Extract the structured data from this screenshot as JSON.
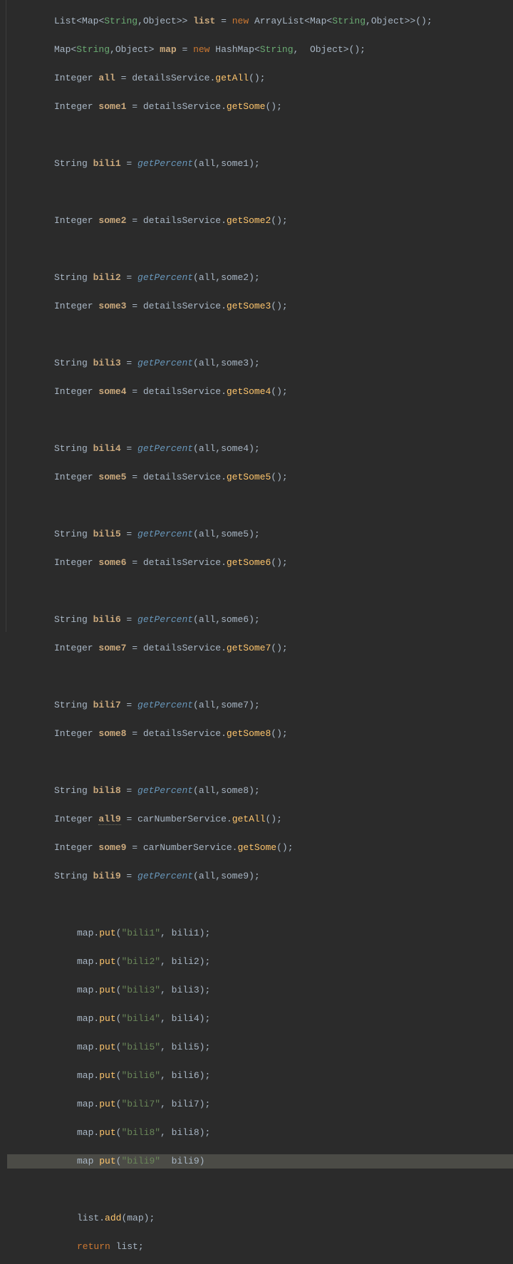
{
  "code": {
    "l1": {
      "t1": "List",
      "t2": "<",
      "t3": "Map",
      "t4": "<",
      "t5": "String",
      "t6": ",",
      "t7": "Object",
      "t8": ">> ",
      "v": "list",
      "eq": " = ",
      "new": "new",
      "sp": " ",
      "cls": "ArrayList",
      "g1": "<",
      "g2": "Map",
      "g3": "<",
      "g4": "String",
      "g5": ",",
      "g6": "Object",
      "g7": ">>",
      "end": "();"
    },
    "l2": {
      "t1": "Map",
      "t2": "<",
      "t3": "String",
      "t4": ",",
      "t5": "Object",
      "t6": "> ",
      "v": "map",
      "eq": " = ",
      "new": "new",
      "sp": " ",
      "cls": "HashMap",
      "g1": "<",
      "g2": "String",
      "g3": ",  ",
      "g4": "Object",
      "g5": ">",
      "end": "();"
    },
    "l3": {
      "t": "Integer ",
      "v": "all",
      "eq": " = ",
      "svc": "detailsService",
      "dot": ".",
      "m": "getAll",
      "end": "();"
    },
    "l4": {
      "t": "Integer ",
      "v": "some1",
      "eq": " = ",
      "svc": "detailsService",
      "dot": ".",
      "m": "getSome",
      "end": "();"
    },
    "b1": {
      "t": "String ",
      "v": "bili1",
      "eq": " = ",
      "f": "getPercent",
      "op": "(",
      "a1": "all",
      "c": ",",
      "a2": "some1",
      "cl": ");"
    },
    "s2": {
      "t": "Integer ",
      "v": "some2",
      "eq": " = ",
      "svc": "detailsService",
      "dot": ".",
      "m": "getSome2",
      "end": "();"
    },
    "b2": {
      "t": "String ",
      "v": "bili2",
      "eq": " = ",
      "f": "getPercent",
      "op": "(",
      "a1": "all",
      "c": ",",
      "a2": "some2",
      "cl": ");"
    },
    "s3": {
      "t": "Integer ",
      "v": "some3",
      "eq": " = ",
      "svc": "detailsService",
      "dot": ".",
      "m": "getSome3",
      "end": "();"
    },
    "b3": {
      "t": "String ",
      "v": "bili3",
      "eq": " = ",
      "f": "getPercent",
      "op": "(",
      "a1": "all",
      "c": ",",
      "a2": "some3",
      "cl": ");"
    },
    "s4": {
      "t": "Integer ",
      "v": "some4",
      "eq": " = ",
      "svc": "detailsService",
      "dot": ".",
      "m": "getSome4",
      "end": "();"
    },
    "b4": {
      "t": "String ",
      "v": "bili4",
      "eq": " = ",
      "f": "getPercent",
      "op": "(",
      "a1": "all",
      "c": ",",
      "a2": "some4",
      "cl": ");"
    },
    "s5": {
      "t": "Integer ",
      "v": "some5",
      "eq": " = ",
      "svc": "detailsService",
      "dot": ".",
      "m": "getSome5",
      "end": "();"
    },
    "b5": {
      "t": "String ",
      "v": "bili5",
      "eq": " = ",
      "f": "getPercent",
      "op": "(",
      "a1": "all",
      "c": ",",
      "a2": "some5",
      "cl": ");"
    },
    "s6": {
      "t": "Integer ",
      "v": "some6",
      "eq": " = ",
      "svc": "detailsService",
      "dot": ".",
      "m": "getSome6",
      "end": "();"
    },
    "b6": {
      "t": "String ",
      "v": "bili6",
      "eq": " = ",
      "f": "getPercent",
      "op": "(",
      "a1": "all",
      "c": ",",
      "a2": "some6",
      "cl": ");"
    },
    "s7": {
      "t": "Integer ",
      "v": "some7",
      "eq": " = ",
      "svc": "detailsService",
      "dot": ".",
      "m": "getSome7",
      "end": "();"
    },
    "b7": {
      "t": "String ",
      "v": "bili7",
      "eq": " = ",
      "f": "getPercent",
      "op": "(",
      "a1": "all",
      "c": ",",
      "a2": "some7",
      "cl": ");"
    },
    "s8": {
      "t": "Integer ",
      "v": "some8",
      "eq": " = ",
      "svc": "detailsService",
      "dot": ".",
      "m": "getSome8",
      "end": "();"
    },
    "b8": {
      "t": "String ",
      "v": "bili8",
      "eq": " = ",
      "f": "getPercent",
      "op": "(",
      "a1": "all",
      "c": ",",
      "a2": "some8",
      "cl": ");"
    },
    "a9": {
      "t": "Integer ",
      "v": "all9",
      "eq": " = ",
      "svc": "carNumberService",
      "dot": ".",
      "m": "getAll",
      "end": "();"
    },
    "s9": {
      "t": "Integer ",
      "v": "some9",
      "eq": " = ",
      "svc": "carNumberService",
      "dot": ".",
      "m": "getSome",
      "end": "();"
    },
    "b9": {
      "t": "String ",
      "v": "bili9",
      "eq": " = ",
      "f": "getPercent",
      "op": "(",
      "a1": "all",
      "c": ",",
      "a2": "some9",
      "cl": ");"
    },
    "p1": {
      "o": "map",
      "d": ".",
      "m": "put",
      "op": "(",
      "s": "\"bili1\"",
      "c": ", ",
      "a": "bili1",
      "cl": ");"
    },
    "p2": {
      "o": "map",
      "d": ".",
      "m": "put",
      "op": "(",
      "s": "\"bili2\"",
      "c": ", ",
      "a": "bili2",
      "cl": ");"
    },
    "p3": {
      "o": "map",
      "d": ".",
      "m": "put",
      "op": "(",
      "s": "\"bili3\"",
      "c": ", ",
      "a": "bili3",
      "cl": ");"
    },
    "p4": {
      "o": "map",
      "d": ".",
      "m": "put",
      "op": "(",
      "s": "\"bili4\"",
      "c": ", ",
      "a": "bili4",
      "cl": ");"
    },
    "p5": {
      "o": "map",
      "d": ".",
      "m": "put",
      "op": "(",
      "s": "\"bili5\"",
      "c": ", ",
      "a": "bili5",
      "cl": ");"
    },
    "p6": {
      "o": "map",
      "d": ".",
      "m": "put",
      "op": "(",
      "s": "\"bili6\"",
      "c": ", ",
      "a": "bili6",
      "cl": ");"
    },
    "p7": {
      "o": "map",
      "d": ".",
      "m": "put",
      "op": "(",
      "s": "\"bili7\"",
      "c": ", ",
      "a": "bili7",
      "cl": ");"
    },
    "p8": {
      "o": "map",
      "d": ".",
      "m": "put",
      "op": "(",
      "s": "\"bili8\"",
      "c": ", ",
      "a": "bili8",
      "cl": ");"
    },
    "p9": {
      "o": "map",
      "sp": " ",
      "m": "put",
      "op": "(",
      "s": "\"bili9\"",
      "c": "  ",
      "a": "bili9",
      "cl": ")"
    },
    "add": {
      "o": "list",
      "d": ".",
      "m": "add",
      "op": "(",
      "a": "map",
      "cl": ");"
    },
    "ret": {
      "k": "return",
      "sp": " ",
      "v": "list",
      "sc": ";"
    }
  }
}
